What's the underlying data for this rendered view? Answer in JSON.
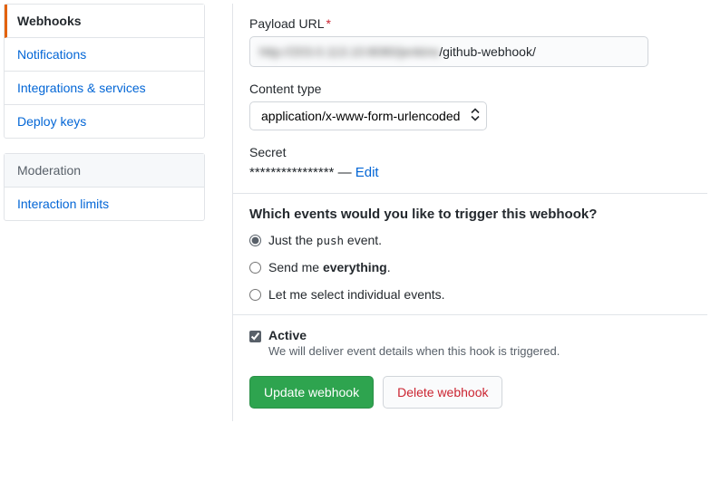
{
  "sidebar": {
    "items": [
      {
        "label": "Webhooks",
        "selected": true
      },
      {
        "label": "Notifications"
      },
      {
        "label": "Integrations & services"
      },
      {
        "label": "Deploy keys"
      }
    ],
    "moderation_header": "Moderation",
    "moderation_items": [
      {
        "label": "Interaction limits"
      }
    ]
  },
  "form": {
    "payload_url_label": "Payload URL",
    "payload_url_hidden_prefix": "http://203.0.113.10:8080/jenkins",
    "payload_url_visible_suffix": "/github-webhook/",
    "content_type_label": "Content type",
    "content_type_value": "application/x-www-form-urlencoded",
    "secret_label": "Secret",
    "secret_masked": "****************",
    "secret_separator": " — ",
    "secret_edit": "Edit",
    "events_heading": "Which events would you like to trigger this webhook?",
    "event_options": {
      "just_push_prefix": "Just the ",
      "just_push_code": "push",
      "just_push_suffix": " event.",
      "everything_prefix": "Send me ",
      "everything_bold": "everything",
      "everything_suffix": ".",
      "individual": "Let me select individual events."
    },
    "active_label": "Active",
    "active_note": "We will deliver event details when this hook is triggered.",
    "update_button": "Update webhook",
    "delete_button": "Delete webhook"
  }
}
